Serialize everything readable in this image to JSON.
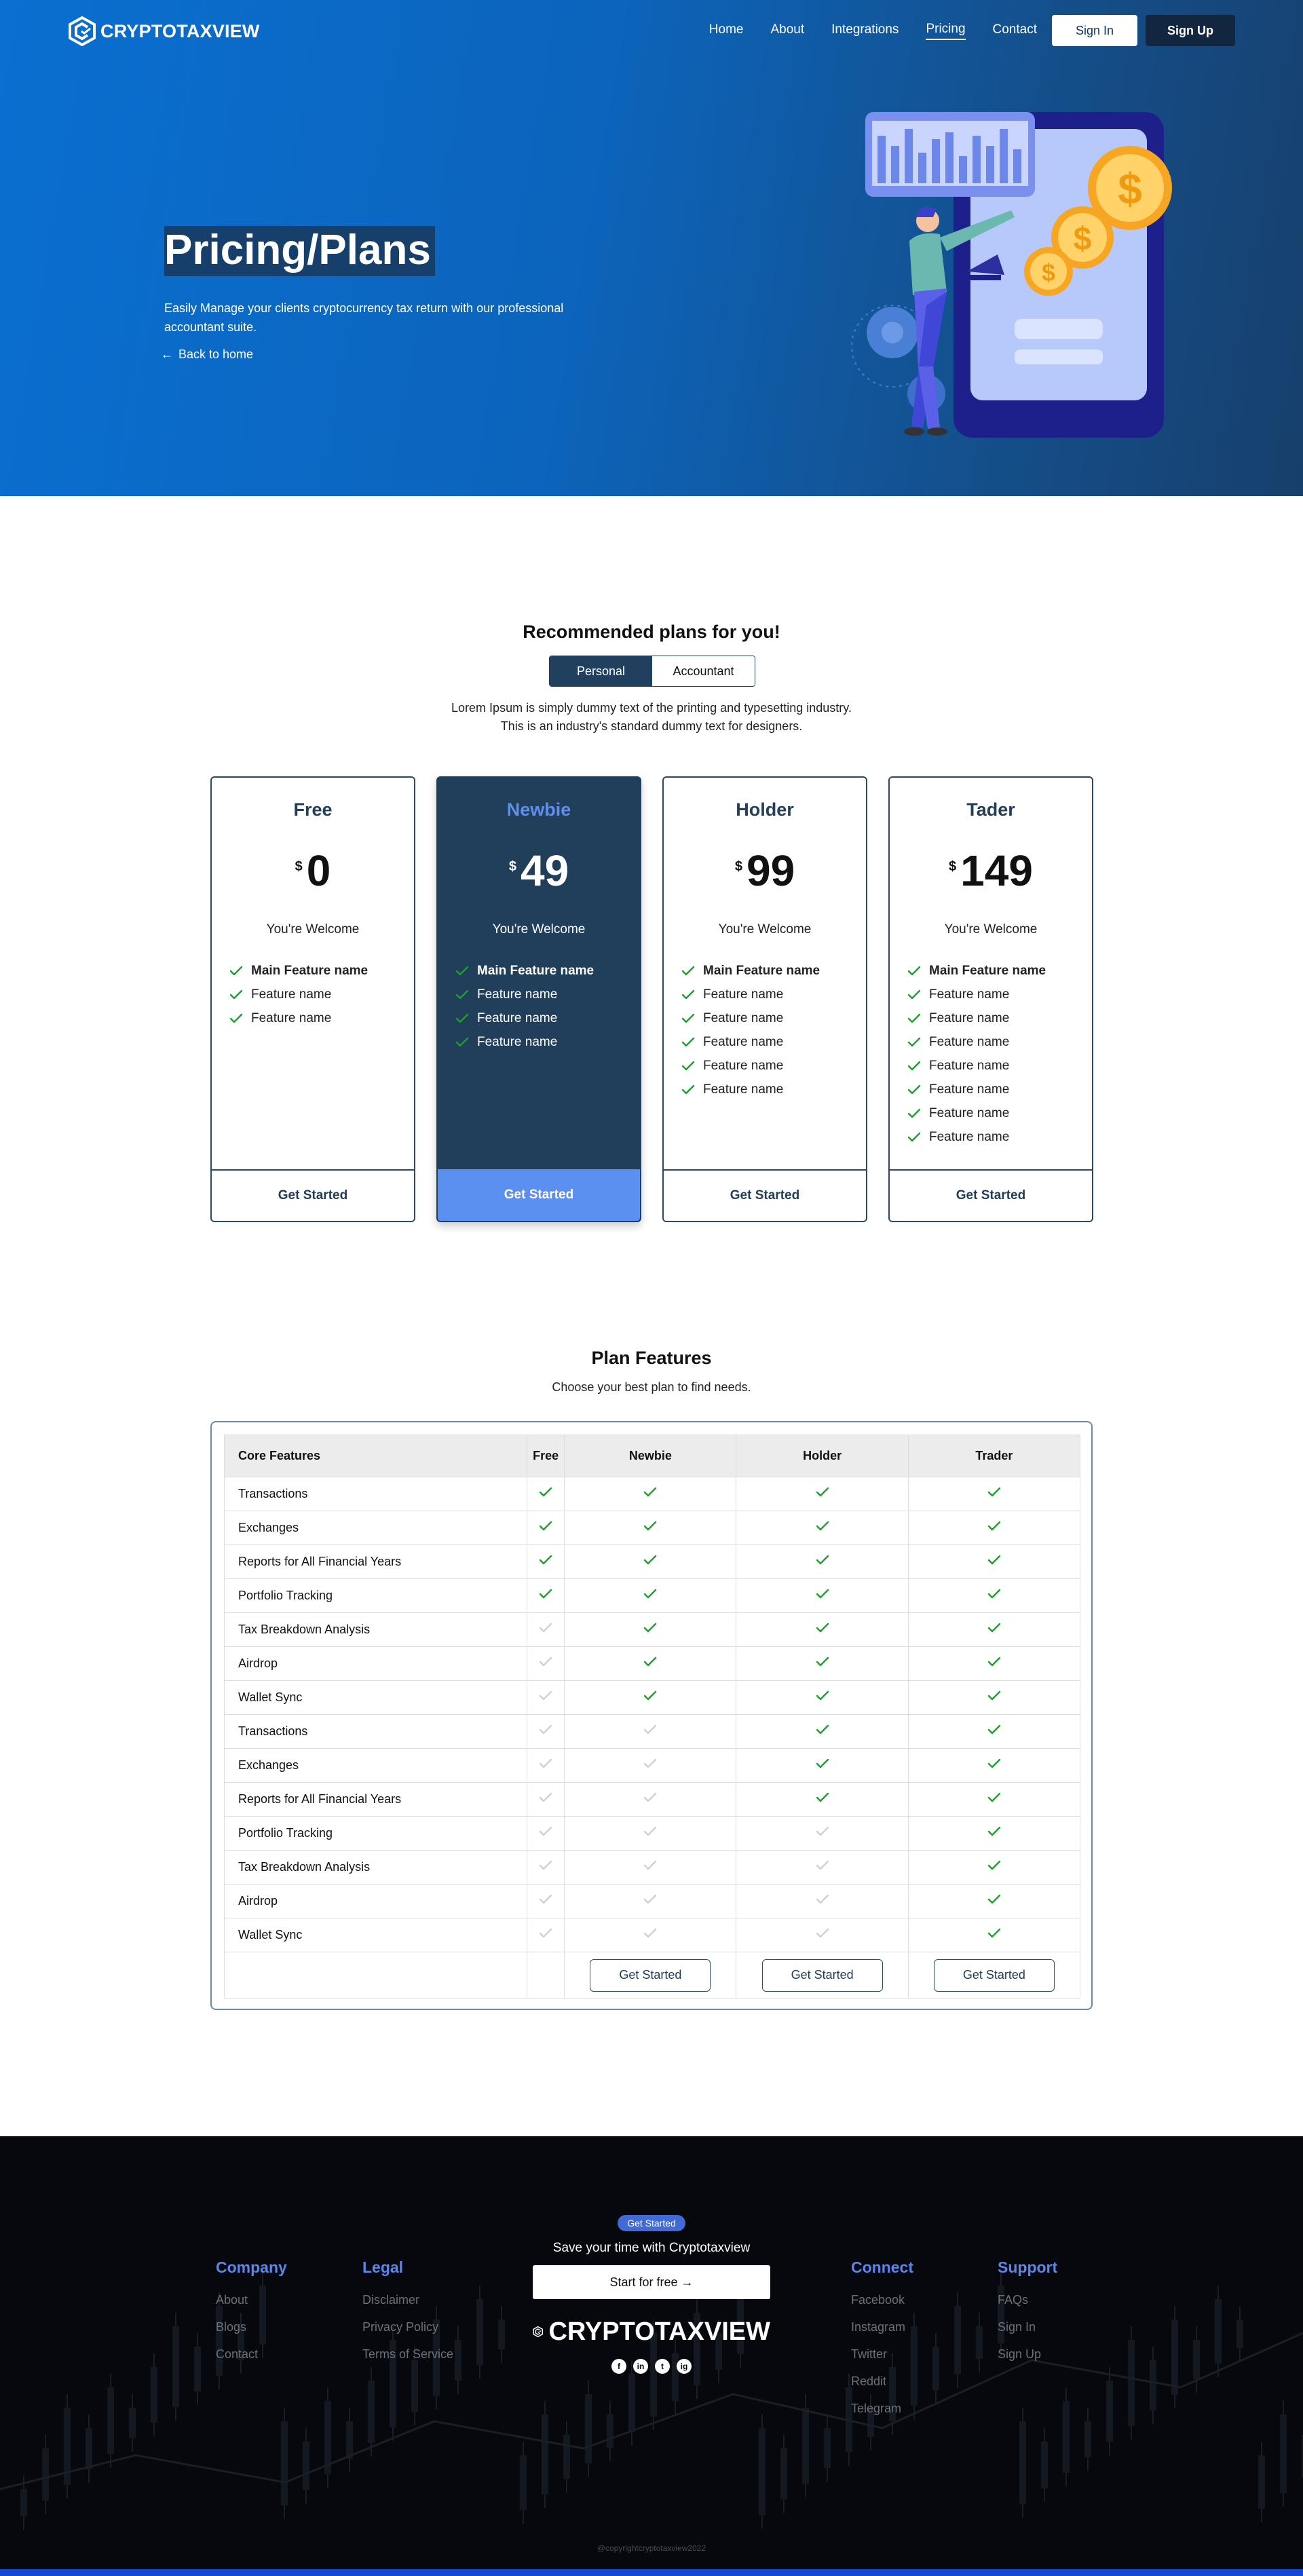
{
  "brand": {
    "name": "CRYPTOTAXVIEW"
  },
  "nav": {
    "links": [
      "Home",
      "About",
      "Integrations",
      "Pricing",
      "Contact"
    ],
    "signin": "Sign In",
    "signup": "Sign Up"
  },
  "hero": {
    "title": "Pricing/Plans",
    "desc": "Easily Manage your clients cryptocurrency tax return with our professional accountant suite.",
    "back": "Back to home"
  },
  "plans": {
    "title": "Recommended plans for you!",
    "toggle": [
      "Personal",
      "Accountant"
    ],
    "lorem1": "Lorem Ipsum is simply dummy text of the printing and typesetting industry.",
    "lorem2": "This is an industry's standard dummy text for designers.",
    "currency": "$",
    "welcome": "You're Welcome",
    "cta": "Get Started",
    "main_feature": "Main Feature name",
    "feature": "Feature name",
    "cards": [
      {
        "name": "Free",
        "price": "0",
        "feature_count": 2
      },
      {
        "name": "Newbie",
        "price": "49",
        "feature_count": 3
      },
      {
        "name": "Holder",
        "price": "99",
        "feature_count": 5
      },
      {
        "name": "Tader",
        "price": "149",
        "feature_count": 7
      }
    ]
  },
  "features": {
    "title": "Plan Features",
    "subtitle": "Choose your best plan to find needs.",
    "header": [
      "Core Features",
      "Free",
      "Newbie",
      "Holder",
      "Trader"
    ],
    "rows": [
      {
        "name": "Transactions",
        "avail": [
          1,
          1,
          1,
          1
        ]
      },
      {
        "name": "Exchanges",
        "avail": [
          1,
          1,
          1,
          1
        ]
      },
      {
        "name": "Reports for All Financial Years",
        "avail": [
          1,
          1,
          1,
          1
        ]
      },
      {
        "name": "Portfolio Tracking",
        "avail": [
          1,
          1,
          1,
          1
        ]
      },
      {
        "name": "Tax Breakdown Analysis",
        "avail": [
          0,
          1,
          1,
          1
        ]
      },
      {
        "name": "Airdrop",
        "avail": [
          0,
          1,
          1,
          1
        ]
      },
      {
        "name": "Wallet Sync",
        "avail": [
          0,
          1,
          1,
          1
        ]
      },
      {
        "name": "Transactions",
        "avail": [
          0,
          0,
          1,
          1
        ]
      },
      {
        "name": "Exchanges",
        "avail": [
          0,
          0,
          1,
          1
        ]
      },
      {
        "name": "Reports for All Financial Years",
        "avail": [
          0,
          0,
          1,
          1
        ]
      },
      {
        "name": "Portfolio Tracking",
        "avail": [
          0,
          0,
          0,
          1
        ]
      },
      {
        "name": "Tax Breakdown Analysis",
        "avail": [
          0,
          0,
          0,
          1
        ]
      },
      {
        "name": "Airdrop",
        "avail": [
          0,
          0,
          0,
          1
        ]
      },
      {
        "name": "Wallet Sync",
        "avail": [
          0,
          0,
          0,
          1
        ]
      }
    ],
    "cta": "Get Started"
  },
  "footer": {
    "company": {
      "title": "Company",
      "links": [
        "About",
        "Blogs",
        "Contact"
      ]
    },
    "legal": {
      "title": "Legal",
      "links": [
        "Disclaimer",
        "Privacy Policy",
        "Terms of Service"
      ]
    },
    "connect": {
      "title": "Connect",
      "links": [
        "Facebook",
        "Instagram",
        "Twitter",
        "Reddit",
        "Telegram"
      ]
    },
    "support": {
      "title": "Support",
      "links": [
        "FAQs",
        "Sign In",
        "Sign Up"
      ]
    },
    "badge": "Get Started",
    "save": "Save your time with Cryptotaxview",
    "start": "Start for free →",
    "socials": [
      "f",
      "in",
      "t",
      "ig"
    ],
    "copyright": "@copyrightcryptotaxview2022"
  },
  "colors": {
    "accent": "#5b8ff0",
    "navy": "#213e5b",
    "check_on": "#1e9e2e",
    "check_off": "#d0d0d0"
  }
}
